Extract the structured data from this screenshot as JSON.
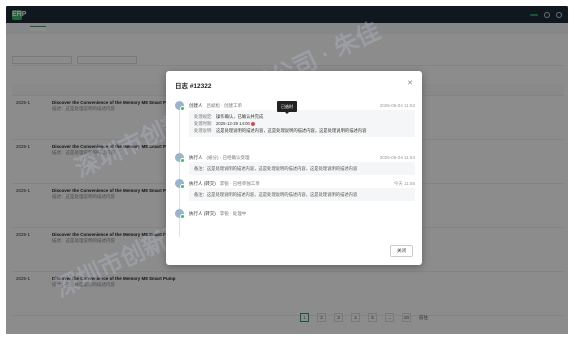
{
  "app": {
    "logo": "ERP",
    "logo_sub": "ERP"
  },
  "modal": {
    "title": "日志 #12322",
    "close_label": "关闭",
    "tooltip": "已逾时",
    "entries": [
      {
        "role": "创建人",
        "who": "吕斌松 · 创建工单",
        "time": "2025-05-04 11:53",
        "lines": [
          {
            "label": "处理规定:",
            "value": "操作确认，已确认并完成"
          },
          {
            "label": "处理时限:",
            "value": "2025-12-29 14:00"
          },
          {
            "label": "处理说明:",
            "value": "这是处理说明的描述内容，这是处理说明的描述内容。这是处理说明的描述内容"
          }
        ]
      },
      {
        "role": "执行人",
        "who": "(被分) · 已经确认受理",
        "time": "2025-05-04 11:53",
        "note": "备注：这是处理说明的描述内容，这是处理说明的描述内容，这是处理说明的描述内容"
      },
      {
        "role": "执行人 (转交)",
        "who": "李锐 · 已经单独工单",
        "time": "今天 11:55",
        "note": "备注：这是处理说明的描述内容，这是处理说明的描述内容，这是处理说明的描述内容"
      },
      {
        "role": "执行人 (转交)",
        "who": "李锐 · 处理中",
        "time": ""
      }
    ]
  },
  "table": {
    "rows": [
      {
        "id": "2025-1",
        "title": "Discover the Convenience of the Memory M8 Smart Pump",
        "desc": "描述：这是处理说明的描述内容"
      },
      {
        "id": "2025-1",
        "title": "Discover the Convenience of the Memory M8 Smart Pump",
        "desc": "描述：这是处理说明的描述内容"
      },
      {
        "id": "2025-1",
        "title": "Discover the Convenience of the Memory M8 Smart Pump",
        "desc": "描述：这是处理说明的描述内容"
      },
      {
        "id": "2025-1",
        "title": "Discover the Convenience of the Memory M8 Smart Pump",
        "desc": "描述：这是处理说明的描述内容"
      },
      {
        "id": "2025-1",
        "title": "Discover the Convenience of the Memory M8 Smart Pump",
        "desc": "描述：这是处理说明的描述内容"
      }
    ]
  },
  "pager": {
    "pages": [
      "1",
      "2",
      "3",
      "4",
      "5",
      "...",
      "20"
    ],
    "next": "前往"
  },
  "watermark": "深圳市创新科技有限公司 · 朱佳"
}
